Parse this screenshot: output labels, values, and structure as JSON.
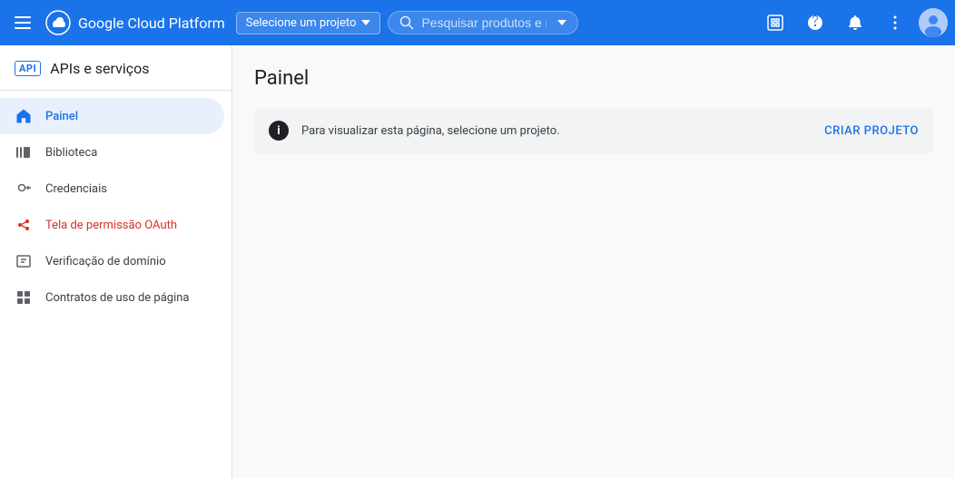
{
  "topnav": {
    "brand": "Google Cloud Platform",
    "project_selector_label": "Selecione um projeto",
    "search_placeholder": "Pesquisar produtos e recursos"
  },
  "sidebar": {
    "api_badge": "API",
    "header_label": "APIs e serviços",
    "items": [
      {
        "id": "painel",
        "label": "Painel",
        "active": true,
        "oauth": false
      },
      {
        "id": "biblioteca",
        "label": "Biblioteca",
        "active": false,
        "oauth": false
      },
      {
        "id": "credenciais",
        "label": "Credenciais",
        "active": false,
        "oauth": false
      },
      {
        "id": "oauth",
        "label": "Tela de permissão OAuth",
        "active": false,
        "oauth": true
      },
      {
        "id": "verificacao",
        "label": "Verificação de domínio",
        "active": false,
        "oauth": false
      },
      {
        "id": "contratos",
        "label": "Contratos de uso de página",
        "active": false,
        "oauth": false
      }
    ]
  },
  "main": {
    "page_title": "Painel",
    "banner_text": "Para visualizar esta página, selecione um projeto.",
    "create_project_label": "CRIAR PROJETO"
  }
}
